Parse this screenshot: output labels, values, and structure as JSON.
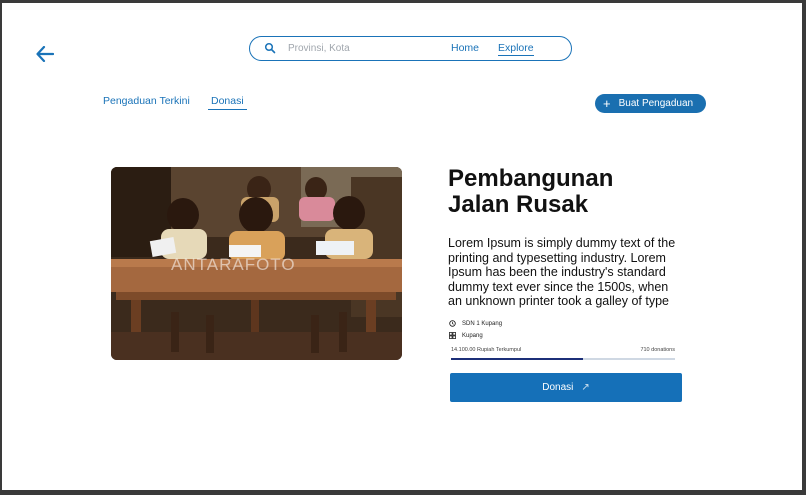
{
  "header": {
    "search": {
      "placeholder": "Provinsi, Kota",
      "value": ""
    },
    "nav": [
      {
        "label": "Home"
      },
      {
        "label": "Explore"
      }
    ]
  },
  "tabs": [
    {
      "label": "Pengaduan Terkini"
    },
    {
      "label": "Donasi"
    }
  ],
  "create_button": {
    "label": "Buat Pengaduan"
  },
  "campaign": {
    "image_watermark": "ANTARAFOTO",
    "title": "Pembangunan Jalan Rusak",
    "description": "Lorem Ipsum is simply dummy text of the printing and typesetting industry. Lorem Ipsum has been the industry's standard dummy text ever since the 1500s, when an unknown printer took a galley of type",
    "school": "SDN 1 Kupang",
    "city": "Kupang",
    "collected": "14.100.00 Rupiah Terkumpul",
    "donations": "710 donations",
    "progress": 0.59,
    "donate_label": "Donasi"
  },
  "colors": {
    "accent": "#1a73b8",
    "button": "#1570b8",
    "progress_fill": "#1c2f78"
  }
}
